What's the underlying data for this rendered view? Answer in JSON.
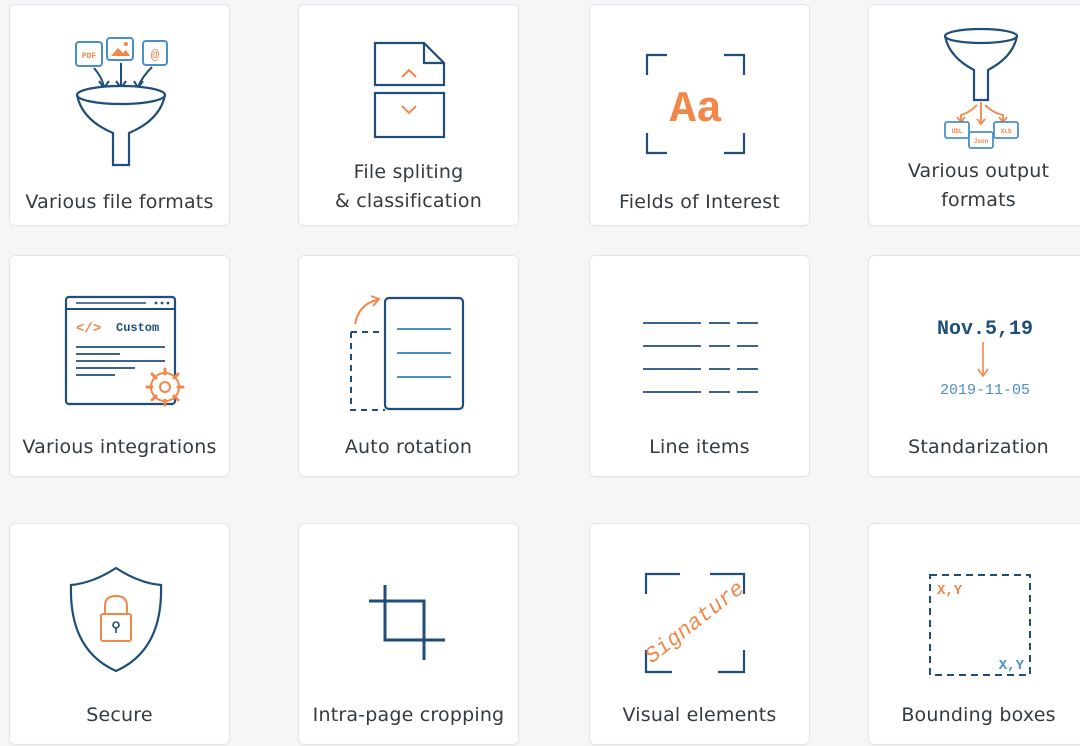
{
  "features": [
    {
      "label": "Various file formats",
      "icon": "funnel-input-icon",
      "badges": [
        "PDF",
        "@"
      ]
    },
    {
      "label_line1": "File spliting",
      "label_line2": "& classification",
      "icon": "file-split-icon"
    },
    {
      "label": "Fields of Interest",
      "icon": "fields-of-interest-icon",
      "glyph": "Aa"
    },
    {
      "label_line1": "Various output",
      "label_line2": "formats",
      "icon": "funnel-output-icon",
      "badges": [
        "UBL",
        "XLS",
        "Json"
      ]
    },
    {
      "label": "Various integrations",
      "icon": "integrations-icon",
      "code_text": "</>",
      "custom_text": "Custom"
    },
    {
      "label": "Auto rotation",
      "icon": "auto-rotation-icon"
    },
    {
      "label": "Line items",
      "icon": "line-items-icon"
    },
    {
      "label": "Standarization",
      "icon": "standardization-icon",
      "date_from": "Nov.5,19",
      "date_to": "2019-11-05"
    },
    {
      "label": "Secure",
      "icon": "shield-lock-icon"
    },
    {
      "label": "Intra-page cropping",
      "icon": "crop-icon"
    },
    {
      "label": "Visual elements",
      "icon": "signature-icon",
      "signature_text": "Signature"
    },
    {
      "label": "Bounding boxes",
      "icon": "bounding-box-icon",
      "coord_text": "X,Y"
    }
  ],
  "colors": {
    "navy": "#1e4e79",
    "orange": "#f2874a",
    "light_blue": "#4a90c8",
    "text": "#333a40",
    "card_border": "#e2e5ea",
    "background": "#f5f6f8"
  }
}
